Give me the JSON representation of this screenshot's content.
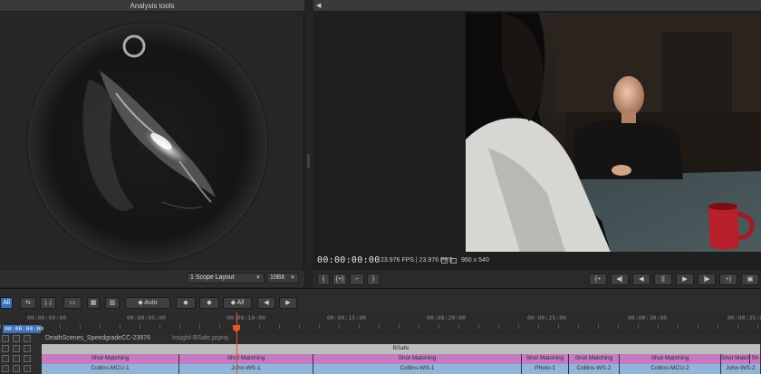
{
  "analysis": {
    "title": "Analysis tools",
    "layout_select": "1 Scope Layout",
    "bit_select": "10Bit"
  },
  "viewer": {
    "timecode": "00:00:00:00",
    "fps_info": "23.976 FPS  |  23.976 FPS",
    "resolution": "960 x 540",
    "left_controls": [
      "{",
      "{+}",
      "⌐",
      "}"
    ],
    "transport": [
      "{+",
      "◀|",
      "◀",
      "||",
      "▶",
      "|▶",
      "+}"
    ]
  },
  "timeline": {
    "all_label": "All",
    "auto_label": "Auto",
    "all2_label": "All",
    "playhead_timecode": "00:00:00:00",
    "ruler_ticks": [
      "00:00:00:00",
      "00:00:05:00",
      "00:00:10:00",
      "00:00:15:00",
      "00:00:20:00",
      "00:00:25:00",
      "00:00:30:00",
      "00:00:35:00"
    ],
    "project_name": "DeathScenes_SpeedgradeCC-23976",
    "project_file": "Insight-BSafe.prproj",
    "bsafe_label": "BSafe",
    "shot_matching": [
      {
        "label": "Shot Matching"
      },
      {
        "label": "Shot Matching"
      },
      {
        "label": "Shot Matching"
      },
      {
        "label": "Shot Matching"
      },
      {
        "label": "Shot Matching"
      },
      {
        "label": "Shot Matching"
      },
      {
        "label": "Shot Matchin"
      },
      {
        "label": "Sh"
      }
    ],
    "clips": [
      {
        "label": "Collins-MCU-1"
      },
      {
        "label": "John-WS-1"
      },
      {
        "label": "Collins-WS-1"
      },
      {
        "label": "Photo-1"
      },
      {
        "label": "Collins-WS-2"
      },
      {
        "label": "Collins-MCU-2"
      },
      {
        "label": "John-WS-2"
      }
    ]
  },
  "colors": {
    "accent_blue": "#3b6fb6",
    "clip_pink": "#c57ac3",
    "clip_blue": "#8fb6d8",
    "playhead": "#e0572a"
  }
}
